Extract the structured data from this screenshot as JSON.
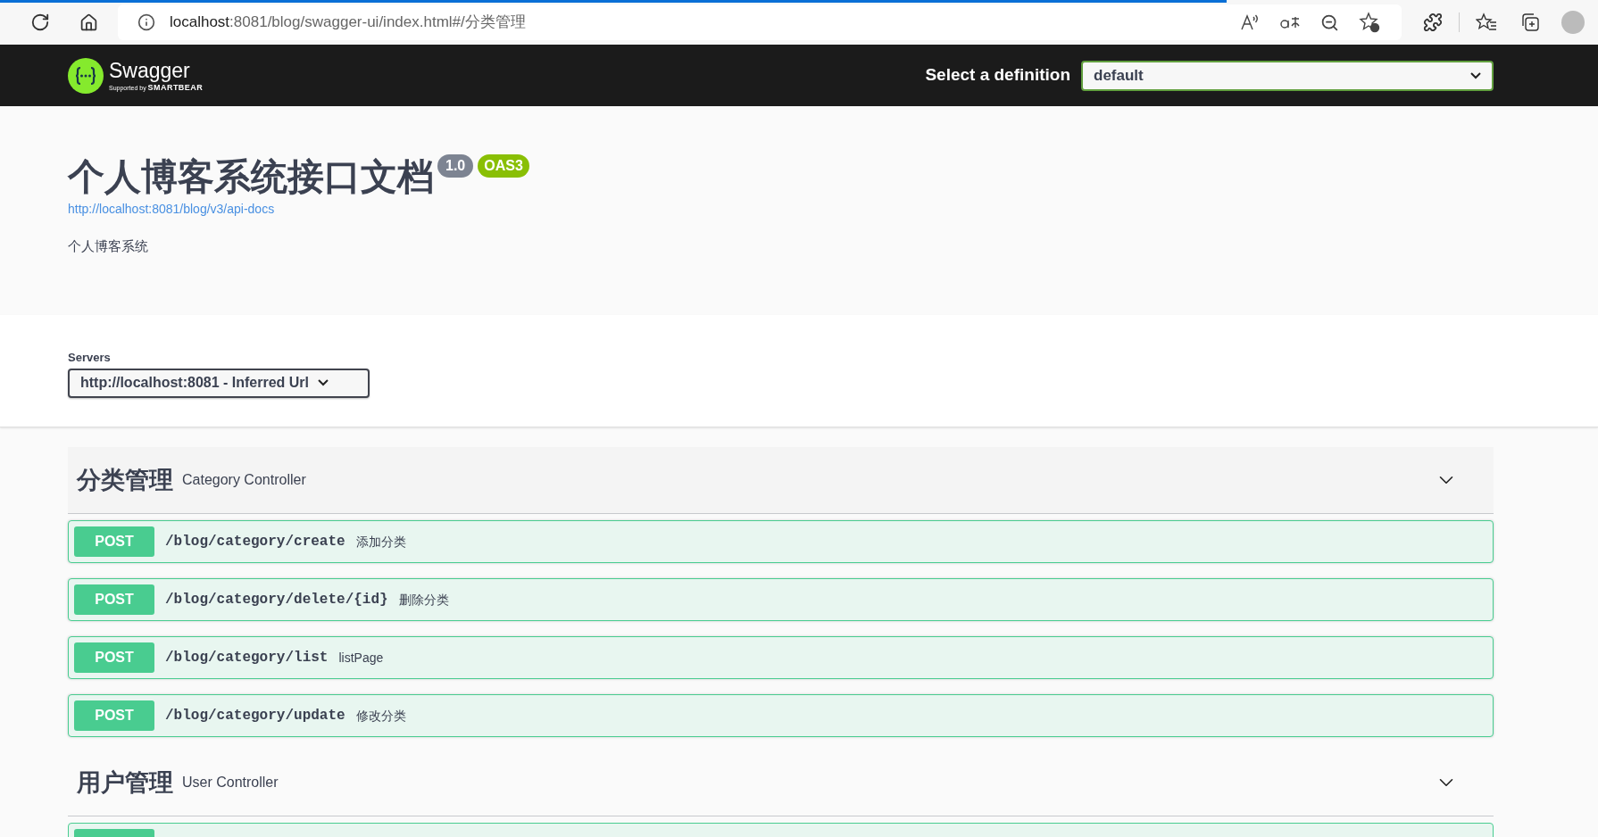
{
  "browser": {
    "url_host": "localhost",
    "url_rest": ":8081/blog/swagger-ui/index.html#/分类管理"
  },
  "topbar": {
    "logo_text": "Swagger",
    "logo_sub_prefix": "Supported by",
    "logo_sub_brand": "SMARTBEAR",
    "definition_label": "Select a definition",
    "definition_value": "default"
  },
  "info": {
    "title": "个人博客系统接口文档",
    "version": "1.0",
    "oas": "OAS3",
    "url": "http://localhost:8081/blog/v3/api-docs",
    "description": "个人博客系统"
  },
  "servers": {
    "label": "Servers",
    "value": "http://localhost:8081 - Inferred Url"
  },
  "tags": [
    {
      "name": "分类管理",
      "description": "Category Controller",
      "expanded": true,
      "operations": [
        {
          "method": "POST",
          "path": "/blog/category/create",
          "summary": "添加分类"
        },
        {
          "method": "POST",
          "path": "/blog/category/delete/{id}",
          "summary": "删除分类"
        },
        {
          "method": "POST",
          "path": "/blog/category/list",
          "summary": "listPage"
        },
        {
          "method": "POST",
          "path": "/blog/category/update",
          "summary": "修改分类"
        }
      ]
    },
    {
      "name": "用户管理",
      "description": "User Controller",
      "expanded": true
    }
  ]
}
